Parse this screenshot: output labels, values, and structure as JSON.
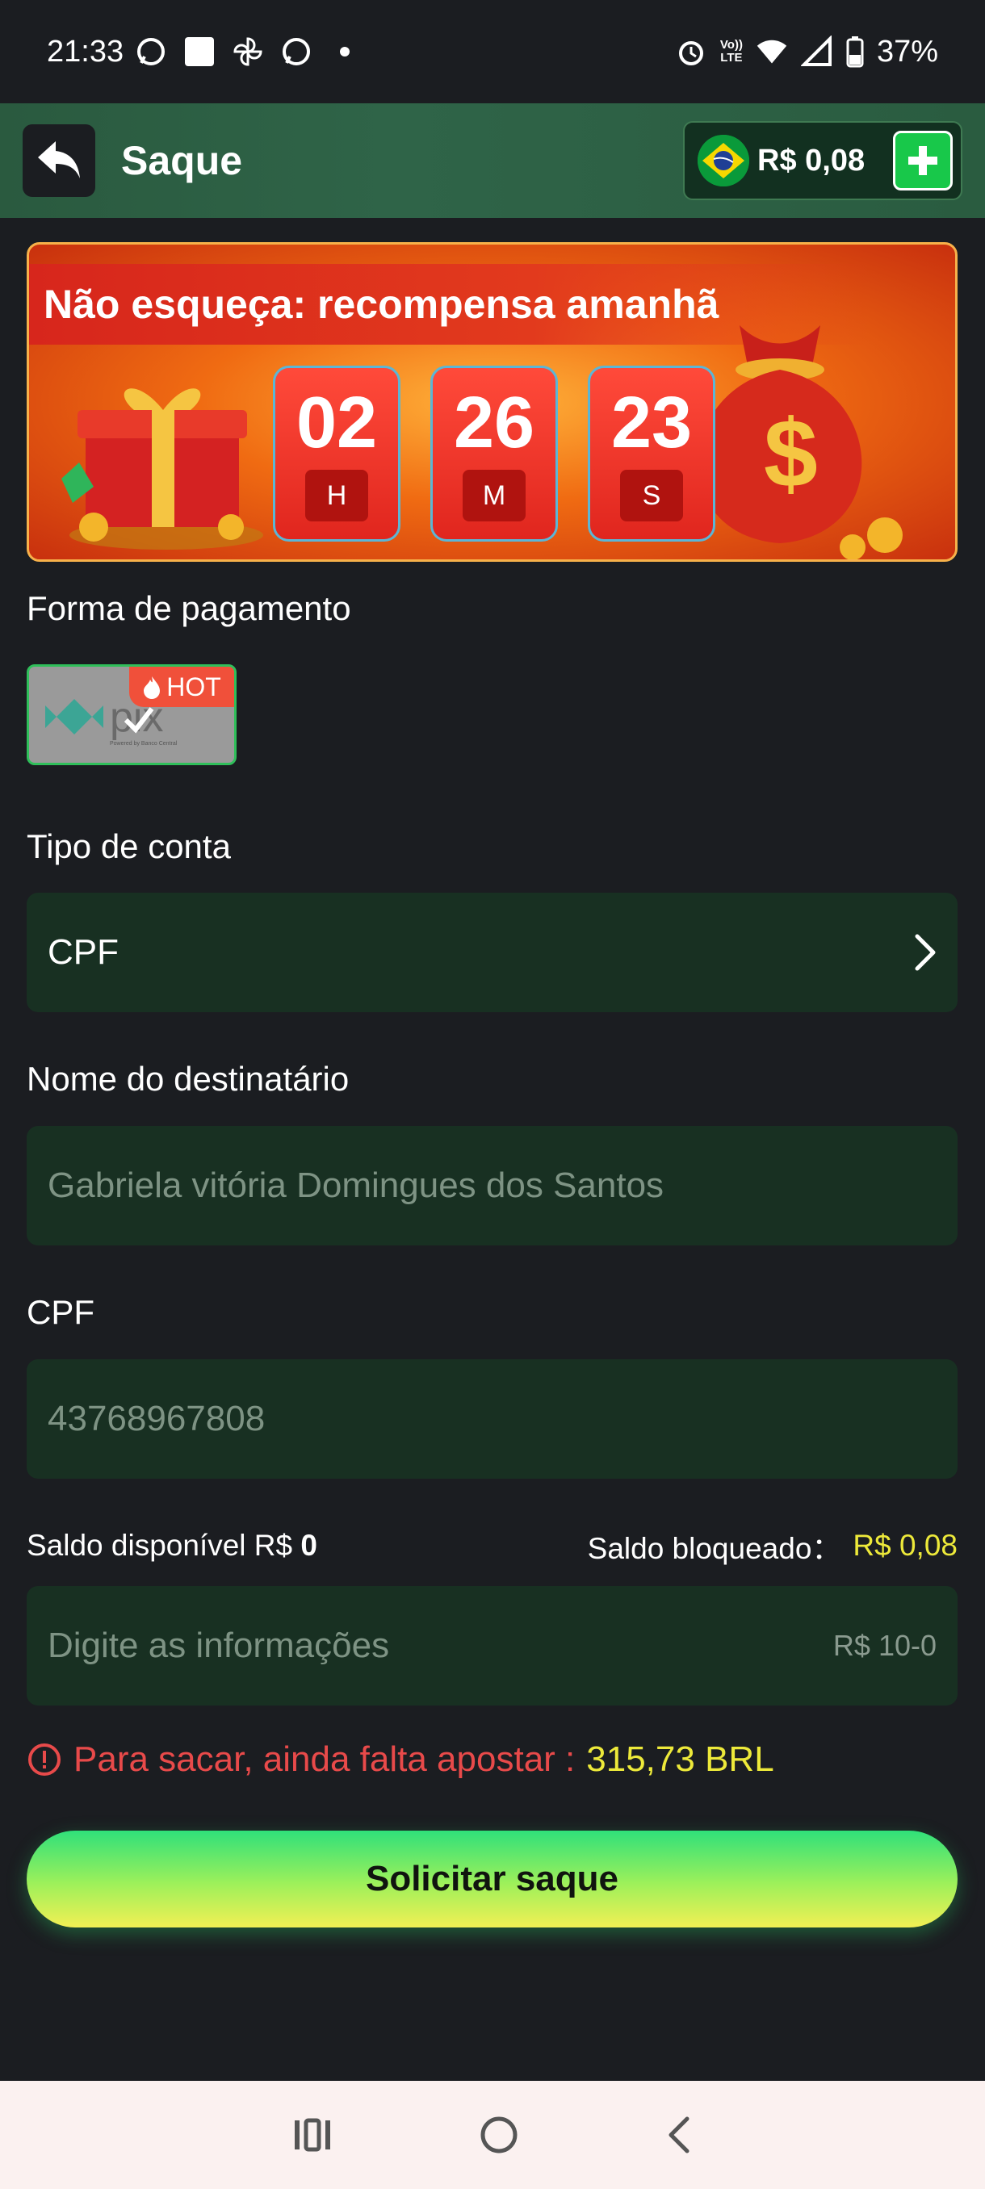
{
  "status_bar": {
    "time": "21:33",
    "battery": "37%",
    "lte_label_top": "Vo))",
    "lte_label_bottom": "LTE"
  },
  "header": {
    "title": "Saque",
    "balance": "R$ 0,08",
    "flag": "brazil-flag"
  },
  "banner": {
    "title": "Não esqueça: recompensa amanhã",
    "hours": "02",
    "minutes": "26",
    "seconds": "23",
    "hours_unit": "H",
    "minutes_unit": "M",
    "seconds_unit": "S"
  },
  "payment": {
    "label": "Forma de pagamento",
    "method": "pix",
    "method_subtitle": "Powered by Banco Central",
    "hot_badge": "HOT"
  },
  "account_type": {
    "label": "Tipo de conta",
    "value": "CPF"
  },
  "recipient": {
    "label": "Nome do destinatário",
    "value": "Gabriela vitória Domingues dos Santos"
  },
  "cpf": {
    "label": "CPF",
    "value": "43768967808"
  },
  "balances": {
    "available_label": "Saldo disponível R$ ",
    "available_value": "0",
    "blocked_label": "Saldo bloqueado：",
    "blocked_value": "R$ 0,08"
  },
  "amount": {
    "placeholder": "Digite as informações",
    "range": "R$ 10-0"
  },
  "warning": {
    "text": "Para sacar, ainda falta apostar :",
    "amount": "315,73 BRL"
  },
  "submit": {
    "label": "Solicitar saque"
  },
  "colors": {
    "background": "#1b1d21",
    "field": "#183022",
    "accent_green": "#18c84a",
    "yellow": "#ede93a",
    "warning_red": "#e84a4a"
  }
}
